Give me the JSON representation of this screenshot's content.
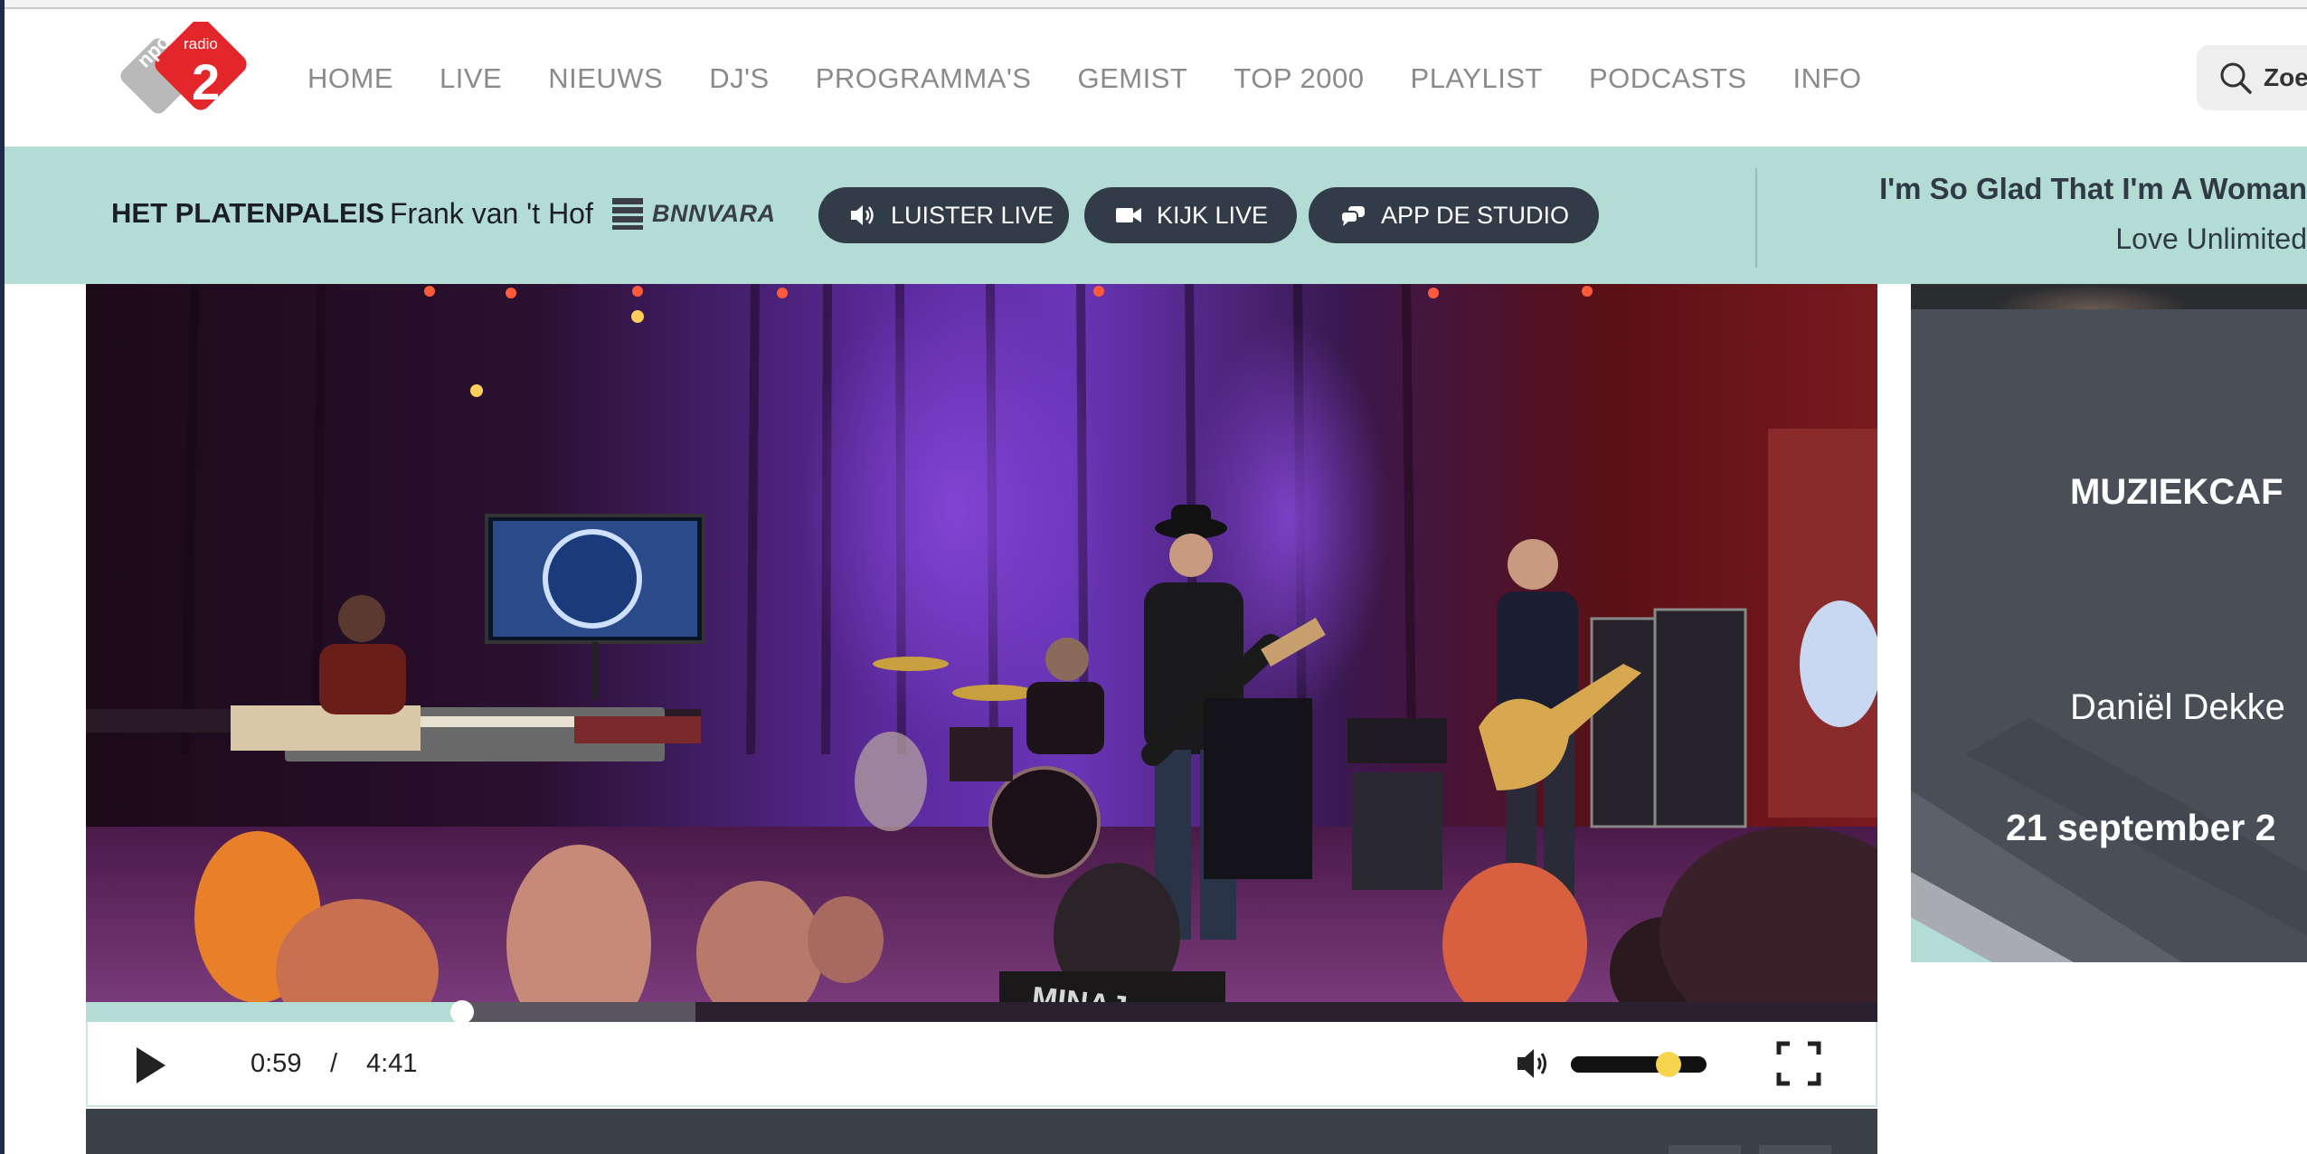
{
  "brand": {
    "logo_text_top": "npo",
    "logo_text_side": "radio",
    "logo_number": "2",
    "accent_red": "#e32629",
    "accent_mint": "#b3dcd5",
    "pill_dark": "#323c48"
  },
  "nav": {
    "items": [
      {
        "label": "HOME"
      },
      {
        "label": "LIVE"
      },
      {
        "label": "NIEUWS"
      },
      {
        "label": "DJ'S"
      },
      {
        "label": "PROGRAMMA'S"
      },
      {
        "label": "GEMIST"
      },
      {
        "label": "TOP 2000"
      },
      {
        "label": "PLAYLIST"
      },
      {
        "label": "PODCASTS"
      },
      {
        "label": "INFO"
      }
    ],
    "search_label": "Zoek",
    "search_icon": "search-icon"
  },
  "now_playing": {
    "show": "HET PLATENPALEIS",
    "host": "Frank van 't Hof",
    "broadcaster": "BNNVARA",
    "buttons": {
      "listen": "LUISTER LIVE",
      "watch": "KIJK LIVE",
      "app": "APP DE STUDIO"
    },
    "track_title": "I'm So Glad That I'm A Woman",
    "track_artist": "Love Unlimited"
  },
  "player": {
    "current_time": "0:59",
    "separator": "/",
    "total_time": "4:41",
    "progress_fraction": 0.21,
    "buffered_fraction": 0.34,
    "volume_fraction": 0.72,
    "overlay_text": "MINAJ"
  },
  "promo": {
    "title": "MUZIEKCAF",
    "subtitle": "Daniël Dekke",
    "date": "21 september 2"
  }
}
